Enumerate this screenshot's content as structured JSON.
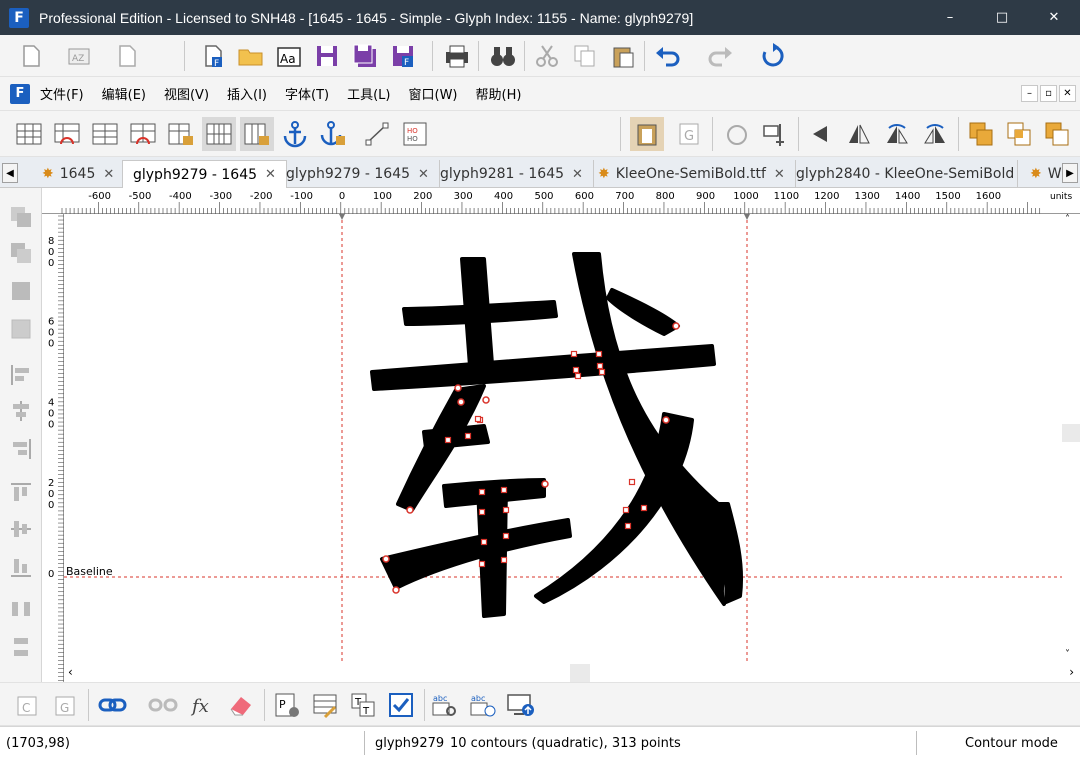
{
  "window": {
    "title": "Professional Edition - Licensed to SNH48 - [1645 - 1645 - Simple - Glyph Index: 1155 - Name: glyph9279]",
    "minimize": "–",
    "maximize": "□",
    "close": "✕"
  },
  "menu": {
    "items": [
      "文件(F)",
      "编辑(E)",
      "视图(V)",
      "插入(I)",
      "字体(T)",
      "工具(L)",
      "窗口(W)",
      "帮助(H)"
    ]
  },
  "tabs": [
    {
      "label": "1645",
      "star": true,
      "active": false
    },
    {
      "label": "glyph9279 - 1645",
      "star": false,
      "active": true
    },
    {
      "label": "glyph9279 - 1645",
      "star": false,
      "active": false
    },
    {
      "label": "glyph9281 - 1645",
      "star": false,
      "active": false
    },
    {
      "label": "KleeOne-SemiBold.ttf",
      "star": true,
      "active": false
    },
    {
      "label": "glyph2840 - KleeOne-SemiBold",
      "star": false,
      "active": false
    },
    {
      "label": "W",
      "star": true,
      "active": false
    }
  ],
  "ruler": {
    "h_labels": [
      "-600",
      "-500",
      "-400",
      "-300",
      "-200",
      "-100",
      "0",
      "100",
      "200",
      "300",
      "400",
      "500",
      "600",
      "700",
      "800",
      "900",
      "1000",
      "1100",
      "1200",
      "1300",
      "1400",
      "1500",
      "1600"
    ],
    "units": "units",
    "v_labels": [
      "800",
      "600",
      "400",
      "200",
      "0"
    ]
  },
  "canvas": {
    "baseline_label": "Baseline",
    "glyph_char": "载"
  },
  "status": {
    "coords": "(1703,98)",
    "glyph_name": "glyph9279",
    "glyph_info": "10 contours (quadratic), 313 points",
    "mode": "Contour mode"
  },
  "colors": {
    "titlebar": "#2e3a46",
    "accent_blue": "#1b5fbf",
    "guide_red": "#d9342b"
  }
}
